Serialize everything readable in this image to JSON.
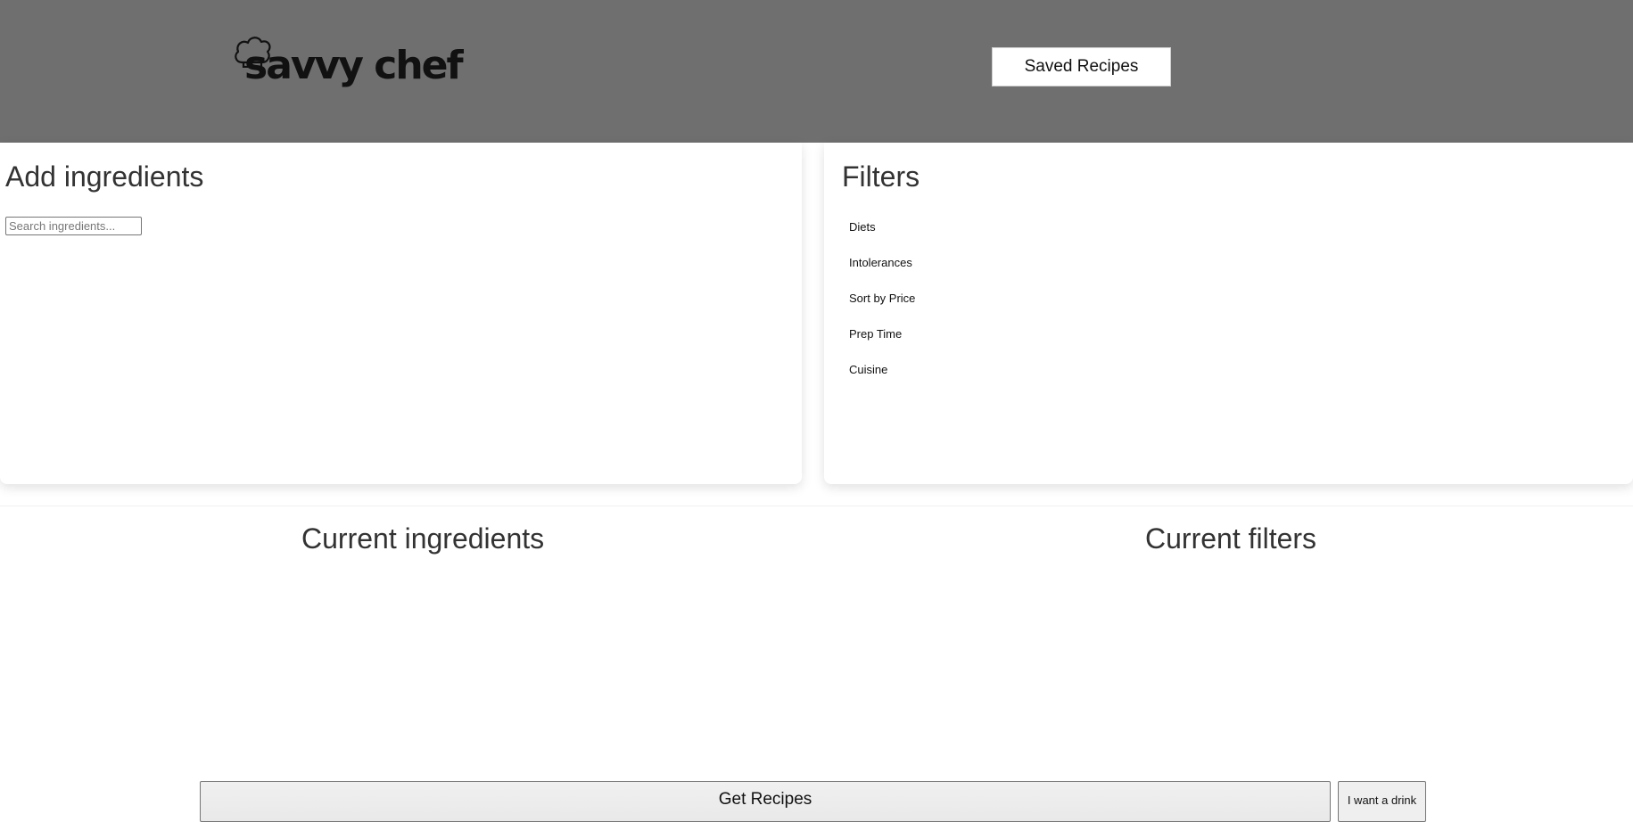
{
  "header": {
    "logo_text": "savvy chef",
    "saved_recipes_label": "Saved Recipes"
  },
  "add_ingredients": {
    "title": "Add ingredients",
    "search_placeholder": "Search ingredients..."
  },
  "filters": {
    "title": "Filters",
    "items": [
      {
        "label": "Diets"
      },
      {
        "label": "Intolerances"
      },
      {
        "label": "Sort by Price"
      },
      {
        "label": "Prep Time"
      },
      {
        "label": "Cuisine"
      }
    ]
  },
  "current": {
    "ingredients_title": "Current ingredients",
    "filters_title": "Current filters"
  },
  "actions": {
    "get_recipes_label": "Get Recipes",
    "drink_label": "I want a drink"
  },
  "colors": {
    "header_bg": "#6f6f6f",
    "text": "#333333"
  }
}
